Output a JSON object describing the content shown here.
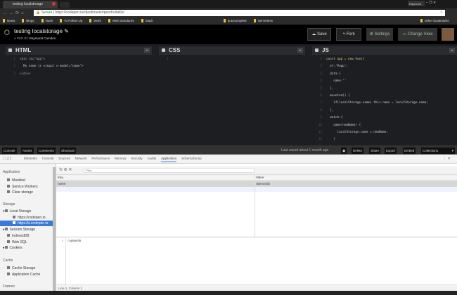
{
  "browser": {
    "tab_title": "testing localstorage",
    "user": "Raymond",
    "url_secure": "Secure",
    "url": "https://codepen.io/cfjedimaster/pen/KodaKb/",
    "bookmarks": [
      "News",
      "Blogs",
      "Node",
      "To Follow Up",
      "Work",
      "Web Standards",
      "Slack",
      "autocomplete",
      "Serverless"
    ],
    "other_bookmarks": "Other bookmarks"
  },
  "pen": {
    "title": "testing localstorage",
    "by_prefix": "A PEN BY",
    "author": "Raymond Camden",
    "buttons": {
      "save": "Save",
      "fork": "Fork",
      "settings": "Settings",
      "change_view": "Change View"
    }
  },
  "editors": {
    "html": {
      "label": "HTML",
      "lines": [
        "<div id=\"app\">",
        "  My name is <input v-model=\"name\">",
        "</div>"
      ]
    },
    "css": {
      "label": "CSS",
      "lines": [
        ""
      ]
    },
    "js": {
      "label": "JS",
      "lines": [
        "const app = new Vue({",
        "  el:'#app',",
        "  data:{",
        "    name:''",
        "  },",
        "  mounted() {",
        "    if(localStorage.name) this.name = localStorage.name;",
        "  },",
        "  watch:{",
        "    name(newName) {",
        "      localStorage.name = newName;",
        "    }",
        "  }",
        "})"
      ]
    }
  },
  "footer": {
    "console": "Console",
    "assets": "Assets",
    "comments": "Comments",
    "shortcuts": "Shortcuts",
    "saved": "Last saved about 1 month ago",
    "delete": "Delete",
    "share": "Share",
    "export": "Export",
    "embed": "Embed",
    "collections": "Collections"
  },
  "devtools": {
    "tabs": [
      "Elements",
      "Console",
      "Sources",
      "Network",
      "Performance",
      "Memory",
      "Security",
      "Audits",
      "Application",
      "SchemaDump"
    ],
    "active_tab": "Application",
    "sidebar": {
      "application_header": "Application",
      "manifest": "Manifest",
      "service_workers": "Service Workers",
      "clear_storage": "Clear storage",
      "storage_header": "Storage",
      "local_storage": "Local Storage",
      "ls_codepen": "https://codepen.io",
      "ls_s_codepen": "https://s.codepen.io",
      "session_storage": "Session Storage",
      "indexeddb": "IndexedDB",
      "web_sql": "Web SQL",
      "cookies": "Cookies",
      "cache_header": "Cache",
      "cache_storage": "Cache Storage",
      "app_cache": "Application Cache",
      "frames_header": "Frames"
    },
    "filter_placeholder": "Filter",
    "table": {
      "key_header": "Key",
      "value_header": "Value",
      "rows": [
        {
          "key": "name",
          "value": "raymundo"
        }
      ]
    },
    "preview": {
      "line": "1",
      "text": "raymundo"
    },
    "status": "Line 1, Column 1"
  }
}
